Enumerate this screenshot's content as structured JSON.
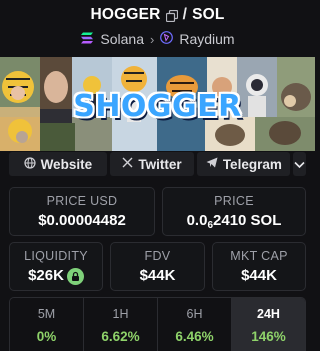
{
  "header": {
    "token": "HOGGER",
    "separator": "/",
    "quote": "SOL",
    "chain": "Solana",
    "dex": "Raydium"
  },
  "banner": {
    "text": "SHOGGER"
  },
  "links": {
    "website": "Website",
    "twitter": "Twitter",
    "telegram": "Telegram"
  },
  "prices": {
    "usd_label": "PRICE USD",
    "usd_value": "$0.00004482",
    "sol_label": "PRICE",
    "sol_prefix": "0.0",
    "sol_sub": "6",
    "sol_digits": "2410 SOL"
  },
  "metrics": {
    "liquidity_label": "LIQUIDITY",
    "liquidity_value": "$26K",
    "fdv_label": "FDV",
    "fdv_value": "$44K",
    "mcap_label": "MKT CAP",
    "mcap_value": "$44K"
  },
  "stats": [
    {
      "label": "5M",
      "value": "0%"
    },
    {
      "label": "1H",
      "value": "6.62%"
    },
    {
      "label": "6H",
      "value": "6.46%"
    },
    {
      "label": "24H",
      "value": "146%"
    }
  ],
  "colors": {
    "positive": "#8fd36a",
    "banner_text": "#3aa5ff",
    "lock": "#7fd17a"
  }
}
